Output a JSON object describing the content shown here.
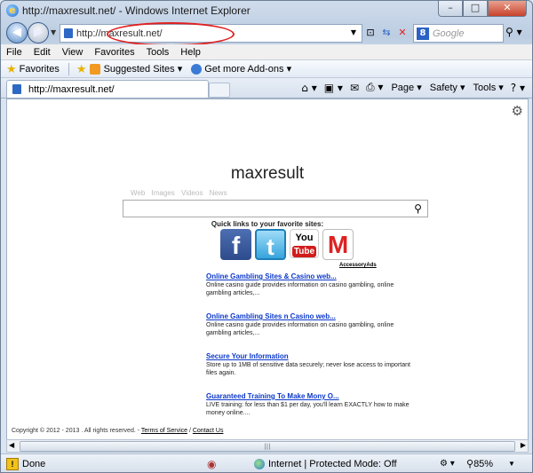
{
  "window": {
    "title": "http://maxresult.net/ - Windows Internet Explorer",
    "buttons": {
      "minimize": "–",
      "maximize": "□",
      "close": "✕"
    }
  },
  "nav": {
    "address": "http://maxresult.net/",
    "search_placeholder": "Google",
    "search_badge": "8"
  },
  "menu": [
    "File",
    "Edit",
    "View",
    "Favorites",
    "Tools",
    "Help"
  ],
  "favorites_bar": {
    "favorites": "Favorites",
    "suggested_sites": "Suggested Sites ▾",
    "addons": "Get more Add-ons ▾"
  },
  "tab": {
    "label": "http://maxresult.net/"
  },
  "command_bar": {
    "page": "Page ▾",
    "safety": "Safety ▾",
    "tools": "Tools ▾"
  },
  "page": {
    "logo": "maxresult",
    "search_tabs": [
      "Web",
      "Images",
      "Videos",
      "News"
    ],
    "quick_links_title": "Quick links to your favorite sites:",
    "social": {
      "facebook": "f",
      "twitter": "t",
      "youtube_you": "You",
      "youtube_tube": "Tube",
      "gmail": "M"
    },
    "ads_label": "AccessoryAds",
    "results": [
      {
        "title": "Online Gambling Sites & Casino web...",
        "desc": "Online casino guide provides information on casino gambling, online gambling articles,..."
      },
      {
        "title": "Online Gambling Sites n Casino web...",
        "desc": "Online casino guide provides information on casino gambling, online gambling articles,..."
      },
      {
        "title": "Secure Your Information",
        "desc": "Store up to 1MB of sensitive data securely; never lose access to important files again."
      },
      {
        "title": "Guaranteed Training To Make Mony O...",
        "desc": "LIVE training: for less than $1 per day, you'll learn EXACTLY how to make money online...."
      }
    ],
    "footer": {
      "copyright": "Copyright © 2012 - 2013 . All rights reserved. - ",
      "terms": "Terms of Service",
      "sep": " / ",
      "contact": "Contact Us"
    }
  },
  "status": {
    "text": "Done",
    "zone": "Internet | Protected Mode: Off",
    "zoom": "85%"
  }
}
